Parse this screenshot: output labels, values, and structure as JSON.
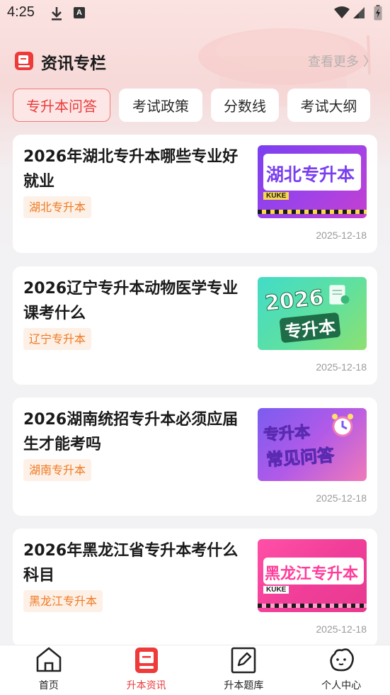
{
  "status_bar": {
    "time": "4:25",
    "a_icon": "A"
  },
  "section": {
    "title": "资讯专栏",
    "more_label": "查看更多",
    "more_chevron": "〉"
  },
  "tabs": [
    {
      "label": "专升本问答",
      "active": true
    },
    {
      "label": "考试政策",
      "active": false
    },
    {
      "label": "分数线",
      "active": false
    },
    {
      "label": "考试大纲",
      "active": false
    }
  ],
  "articles": [
    {
      "title": "2026年湖北专升本哪些专业好就业",
      "tag": "湖北专升本",
      "date": "2025-12-18",
      "thumb_text": "湖北专升本",
      "thumb_badge": "KUKE"
    },
    {
      "title": "2026辽宁专升本动物医学专业课考什么",
      "tag": "辽宁专升本",
      "date": "2025-12-18",
      "thumb_text_1": "2026",
      "thumb_text_2": "专升本"
    },
    {
      "title": "2026湖南统招专升本必须应届生才能考吗",
      "tag": "湖南专升本",
      "date": "2025-12-18",
      "thumb_text_1": "专升本",
      "thumb_text_2": "常见问答"
    },
    {
      "title": "2026年黑龙江省专升本考什么科目",
      "tag": "黑龙江专升本",
      "date": "2025-12-18",
      "thumb_text": "黑龙江专升本",
      "thumb_badge": "KUKE"
    }
  ],
  "bottom_nav": [
    {
      "label": "首页",
      "icon": "home-icon",
      "active": false
    },
    {
      "label": "升本资讯",
      "icon": "news-icon",
      "active": true
    },
    {
      "label": "升本题库",
      "icon": "edit-icon",
      "active": false
    },
    {
      "label": "个人中心",
      "icon": "profile-icon",
      "active": false
    }
  ],
  "colors": {
    "accent": "#e93b3b",
    "tag_text": "#f07a22",
    "tag_bg": "#fdf0e6"
  }
}
